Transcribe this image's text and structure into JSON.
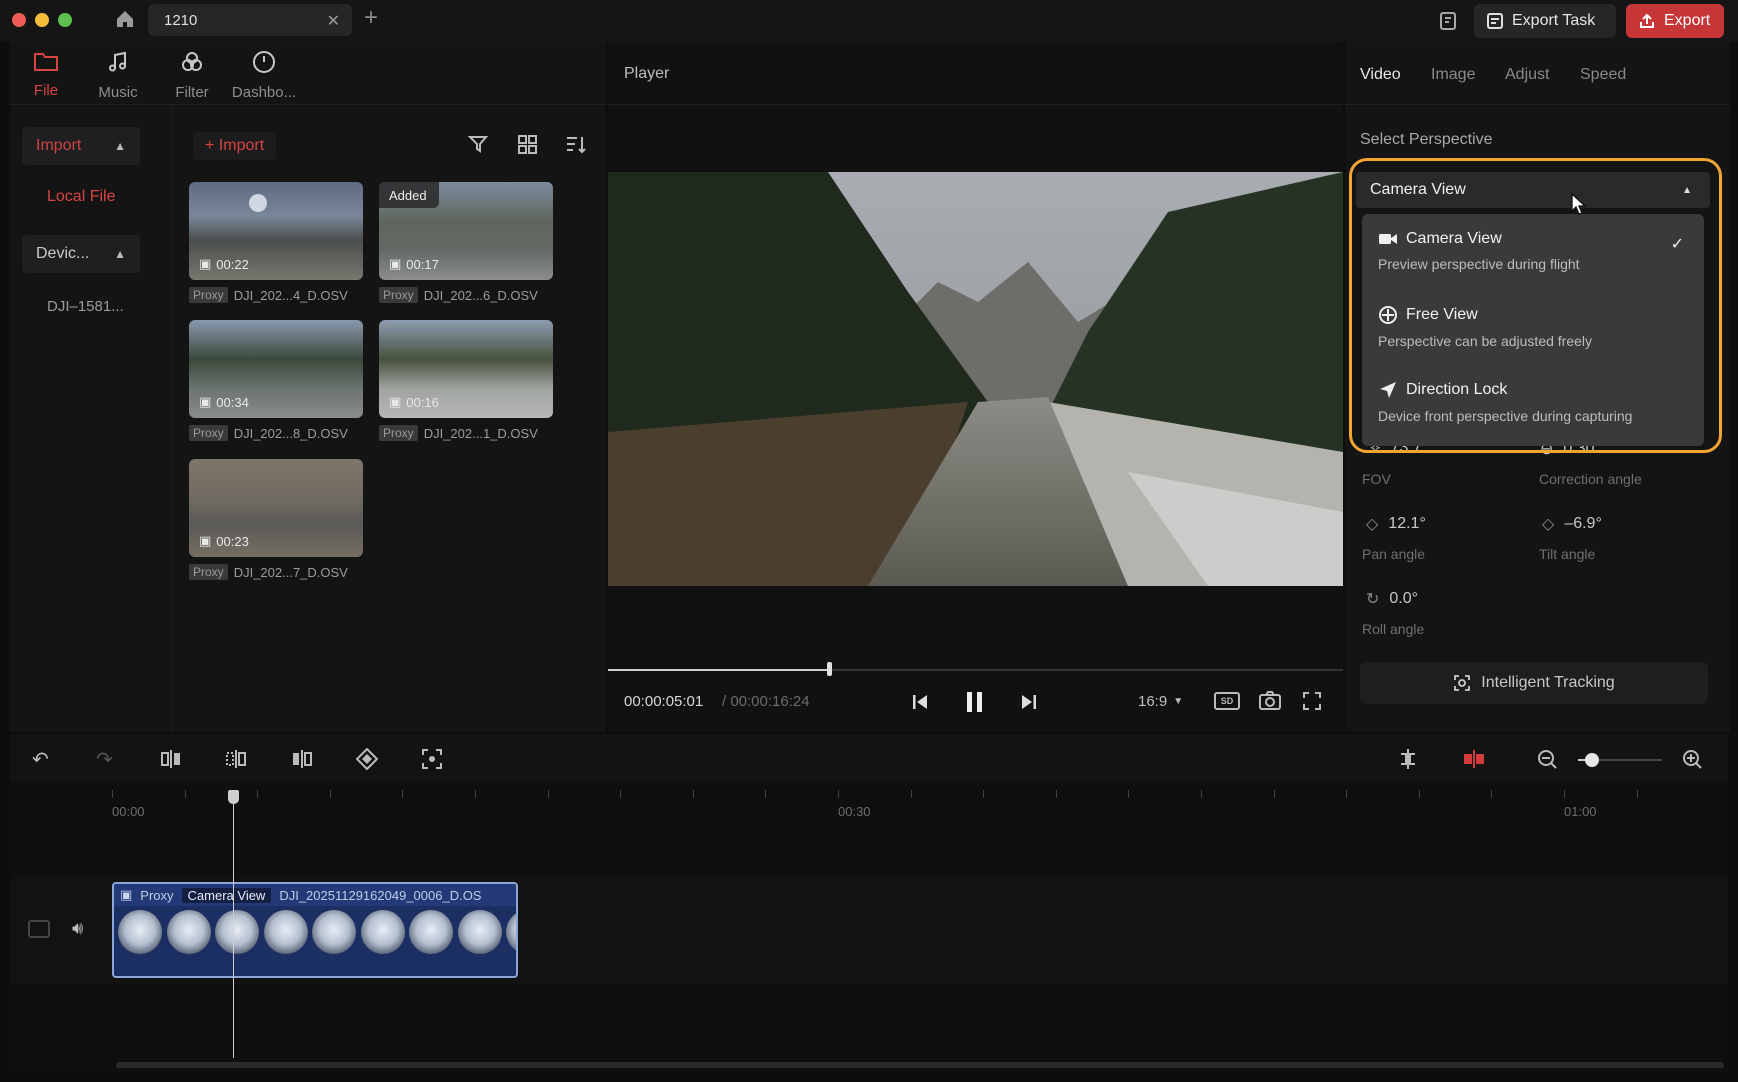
{
  "titlebar": {
    "tab_title": "1210",
    "export_task_label": "Export Task",
    "export_label": "Export",
    "accent": "#d63a3a"
  },
  "media_tabs": [
    {
      "label": "File",
      "icon": "folder-icon",
      "active": true
    },
    {
      "label": "Music",
      "icon": "music-icon",
      "active": false
    },
    {
      "label": "Filter",
      "icon": "filter-circles-icon",
      "active": false
    },
    {
      "label": "Dashbo...",
      "icon": "gauge-icon",
      "active": false
    }
  ],
  "left_nav": {
    "import_label": "Import",
    "local_file_label": "Local File",
    "device_label": "Devic...",
    "device_item": "DJI–1581..."
  },
  "media": {
    "import_button": "+ Import",
    "proxy_label": "Proxy",
    "added_label": "Added",
    "items": [
      {
        "duration": "00:22",
        "name": "DJI_202...4_D.OSV"
      },
      {
        "duration": "00:17",
        "name": "DJI_202...6_D.OSV"
      },
      {
        "duration": "00:34",
        "name": "DJI_202...8_D.OSV"
      },
      {
        "duration": "00:16",
        "name": "DJI_202...1_D.OSV"
      },
      {
        "duration": "00:23",
        "name": "DJI_202...7_D.OSV"
      }
    ]
  },
  "player": {
    "title": "Player",
    "current_time": "00:00:05:01",
    "total_time": "/ 00:00:16:24",
    "aspect": "16:9",
    "quality": "SD",
    "progress": 0.3
  },
  "right_panel": {
    "tabs": [
      "Video",
      "Image",
      "Adjust",
      "Speed"
    ],
    "section_title": "Select Perspective",
    "selected": "Camera View",
    "options": [
      {
        "title": "Camera View",
        "desc": "Preview perspective during flight",
        "icon": "video-camera-icon",
        "checked": true
      },
      {
        "title": "Free View",
        "desc": "Perspective can be adjusted freely",
        "icon": "move-crosshair-icon",
        "checked": false
      },
      {
        "title": "Direction Lock",
        "desc": "Device front perspective during capturing",
        "icon": "navigation-arrow-icon",
        "checked": false
      }
    ],
    "params": {
      "fov_value": "73.7°",
      "fov_label": "FOV",
      "correction_value": "0.30",
      "correction_label": "Correction angle",
      "pan_value": "12.1°",
      "pan_label": "Pan angle",
      "tilt_value": "–6.9°",
      "tilt_label": "Tilt angle",
      "roll_value": "0.0°",
      "roll_label": "Roll angle"
    },
    "tracking_label": "Intelligent Tracking",
    "highlight_color": "#f3a433"
  },
  "timeline": {
    "ticks": [
      "00:00",
      "00:30",
      "01:00"
    ],
    "clip": {
      "proxy": "Proxy",
      "view": "Camera View",
      "name": "DJI_20251129162049_0006_D.OS"
    }
  }
}
